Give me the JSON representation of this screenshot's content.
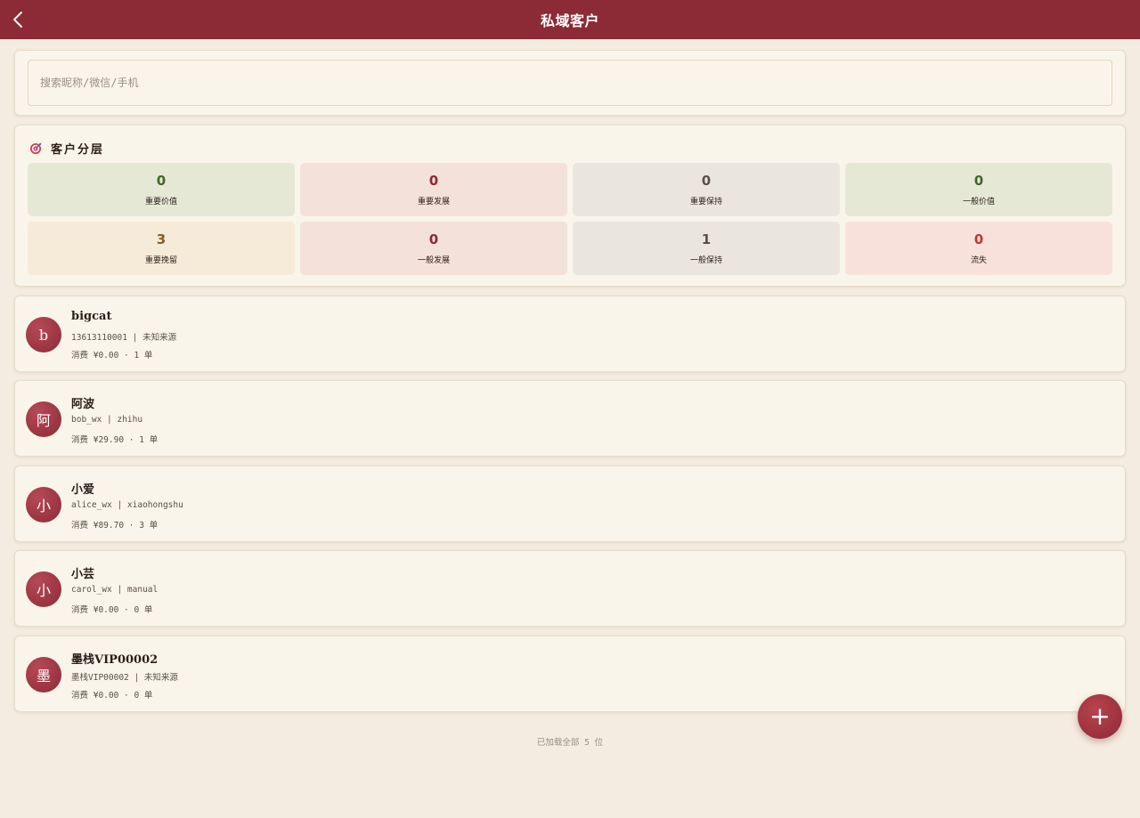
{
  "header": {
    "title": "私域客户",
    "back_icon": "chevron-left-icon"
  },
  "search": {
    "placeholder": "搜索昵称/微信/手机",
    "value": ""
  },
  "segments": {
    "title": "客户分层",
    "icon": "target-icon",
    "items": [
      {
        "count": "0",
        "label": "重要价值",
        "bg": "#e6e8d6",
        "color": "#3e6a24"
      },
      {
        "count": "0",
        "label": "重要发展",
        "bg": "#f4e2da",
        "color": "#8c2a35"
      },
      {
        "count": "0",
        "label": "重要保持",
        "bg": "#ebe6dd",
        "color": "#5a4f47"
      },
      {
        "count": "0",
        "label": "一般价值",
        "bg": "#e6e8d6",
        "color": "#3e6a24"
      },
      {
        "count": "3",
        "label": "重要挽留",
        "bg": "#f6ead9",
        "color": "#8b5a20"
      },
      {
        "count": "0",
        "label": "一般发展",
        "bg": "#f4e2da",
        "color": "#8c2a35"
      },
      {
        "count": "1",
        "label": "一般保持",
        "bg": "#ebe6dd",
        "color": "#5a4f47"
      },
      {
        "count": "0",
        "label": "流失",
        "bg": "#f7e1da",
        "color": "#c8333a"
      }
    ]
  },
  "customers": [
    {
      "initial": "b",
      "name": "bigcat",
      "meta": "13613110001 | 未知来源",
      "spend": "消费 ¥0.00 · 1 单"
    },
    {
      "initial": "阿",
      "name": "阿波",
      "meta": "bob_wx | zhihu",
      "spend": "消费 ¥29.90 · 1 单"
    },
    {
      "initial": "小",
      "name": "小爱",
      "meta": "alice_wx | xiaohongshu",
      "spend": "消费 ¥89.70 · 3 单"
    },
    {
      "initial": "小",
      "name": "小芸",
      "meta": "carol_wx | manual",
      "spend": "消费 ¥0.00 · 0 单"
    },
    {
      "initial": "墨",
      "name": "墨栈VIP00002",
      "meta": "墨栈VIP00002 | 未知来源",
      "spend": "消费 ¥0.00 · 0 单"
    }
  ],
  "footer": {
    "text": "已加载全部 5 位"
  },
  "fab": {
    "label": "+",
    "icon": "plus-icon"
  }
}
